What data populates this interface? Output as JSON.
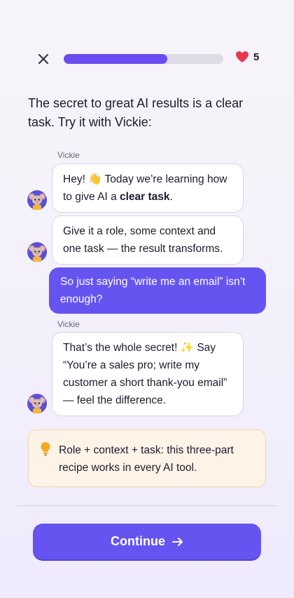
{
  "header": {
    "progress": 0.65,
    "lives": "5"
  },
  "intro": "The secret to great AI results is a clear task. Try it with Vickie:",
  "chat": {
    "sender_1": "Vickie",
    "msg_1a_pre": "Hey! 👋 Today we’re learning how to give AI a ",
    "msg_1a_bold": "clear task",
    "msg_1a_post": ".",
    "msg_1b": "Give it a role, some context and one task — the result transforms.",
    "user_msg": "So just saying “write me an email” isn’t enough?",
    "sender_2": "Vickie",
    "msg_2": "That’s the whole secret! ✨ Say “You’re a sales pro; write my customer a short thank-you email” — feel the difference."
  },
  "tip": {
    "text": "Role + context + task: this three-part recipe works in every AI tool."
  },
  "footer": {
    "continue_label": "Continue"
  },
  "colors": {
    "accent": "#6654f0",
    "progress": "#6a4cf0",
    "heart": "#e8384f",
    "tip_bg": "#fdf3e6"
  }
}
